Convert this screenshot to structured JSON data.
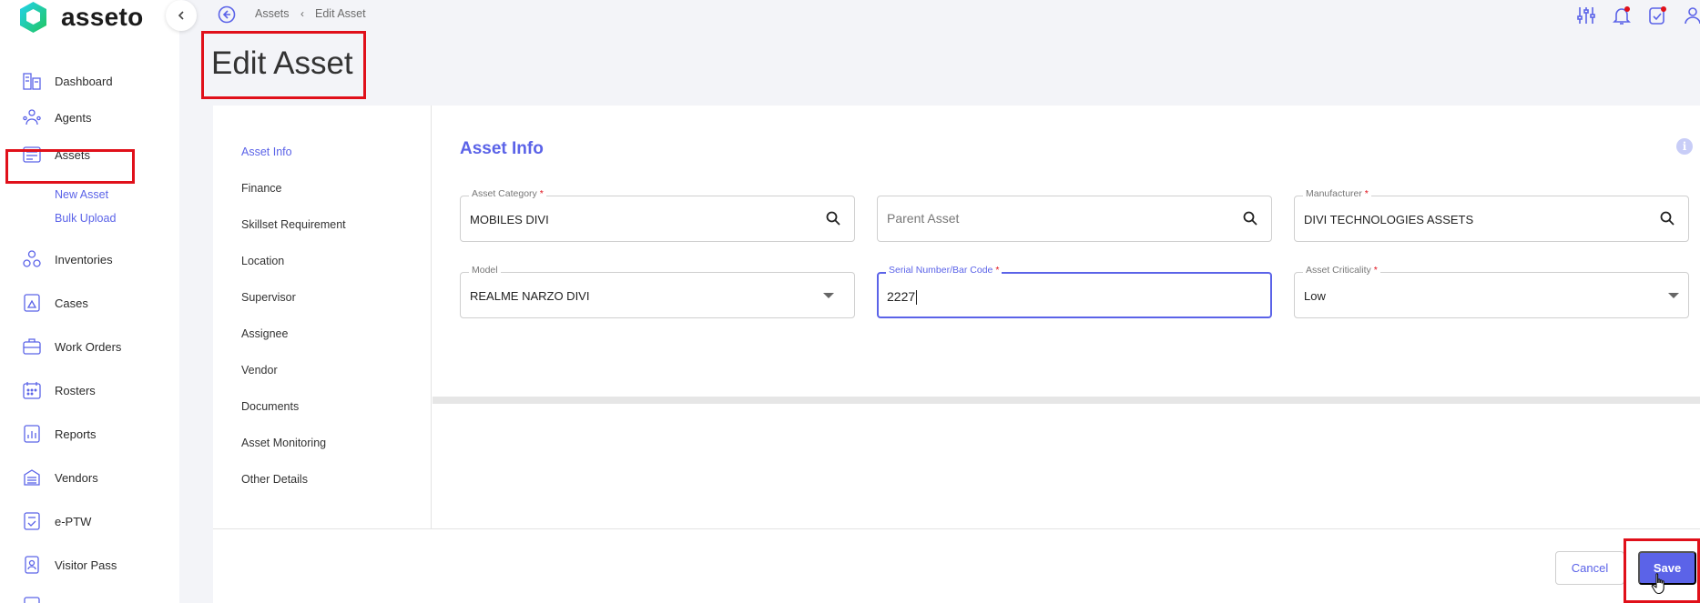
{
  "app": {
    "name": "asseto"
  },
  "sidebar": {
    "items": [
      {
        "label": "Dashboard",
        "icon": "dashboard-icon"
      },
      {
        "label": "Agents",
        "icon": "agents-icon"
      },
      {
        "label": "Assets",
        "icon": "assets-icon"
      },
      {
        "label": "Inventories",
        "icon": "inventories-icon"
      },
      {
        "label": "Cases",
        "icon": "cases-icon"
      },
      {
        "label": "Work Orders",
        "icon": "work-orders-icon"
      },
      {
        "label": "Rosters",
        "icon": "rosters-icon"
      },
      {
        "label": "Reports",
        "icon": "reports-icon"
      },
      {
        "label": "Vendors",
        "icon": "vendors-icon"
      },
      {
        "label": "e-PTW",
        "icon": "eptw-icon"
      },
      {
        "label": "Visitor Pass",
        "icon": "visitor-pass-icon"
      }
    ],
    "subitems": [
      "New Asset",
      "Bulk Upload"
    ]
  },
  "breadcrumb": {
    "parent": "Assets",
    "current": "Edit Asset"
  },
  "page": {
    "title": "Edit Asset"
  },
  "tabs": [
    "Asset Info",
    "Finance",
    "Skillset Requirement",
    "Location",
    "Supervisor",
    "Assignee",
    "Vendor",
    "Documents",
    "Asset Monitoring",
    "Other Details"
  ],
  "section": {
    "title": "Asset Info"
  },
  "fields": {
    "category": {
      "label": "Asset Category",
      "value": "MOBILES DIVI"
    },
    "parent": {
      "placeholder": "Parent Asset"
    },
    "manufacturer": {
      "label": "Manufacturer",
      "value": "DIVI TECHNOLOGIES ASSETS"
    },
    "model": {
      "label": "Model",
      "value": "REALME NARZO DIVI"
    },
    "serial": {
      "label": "Serial Number/Bar Code",
      "value": "2227"
    },
    "criticality": {
      "label": "Asset Criticality",
      "value": "Low"
    }
  },
  "buttons": {
    "cancel": "Cancel",
    "save": "Save"
  },
  "colors": {
    "accent": "#5b63e8",
    "highlight": "#e0101a"
  }
}
